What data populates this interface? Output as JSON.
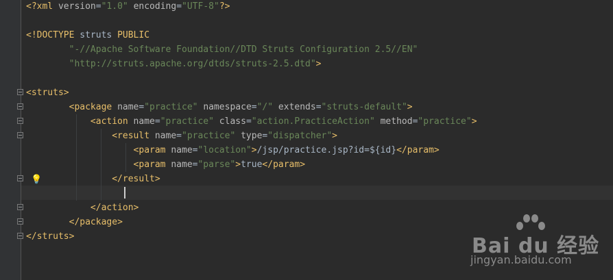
{
  "editor": {
    "lines": [
      {
        "segments": [
          {
            "text": "<?xml ",
            "cls": "t-tag"
          },
          {
            "text": "version",
            "cls": "t-attr"
          },
          {
            "text": "=",
            "cls": "t-text"
          },
          {
            "text": "\"1.0\"",
            "cls": "t-val"
          },
          {
            "text": " ",
            "cls": "t-text"
          },
          {
            "text": "encoding",
            "cls": "t-attr"
          },
          {
            "text": "=",
            "cls": "t-text"
          },
          {
            "text": "\"UTF-8\"",
            "cls": "t-val"
          },
          {
            "text": "?>",
            "cls": "t-tag"
          }
        ]
      },
      {
        "segments": []
      },
      {
        "segments": [
          {
            "text": "<!DOCTYPE ",
            "cls": "t-tag"
          },
          {
            "text": "struts ",
            "cls": "t-text"
          },
          {
            "text": "PUBLIC",
            "cls": "t-tag"
          }
        ]
      },
      {
        "segments": [
          {
            "text": "        ",
            "cls": "t-text"
          },
          {
            "text": "\"-//Apache Software Foundation//DTD Struts Configuration 2.5//EN\"",
            "cls": "t-val"
          }
        ]
      },
      {
        "segments": [
          {
            "text": "        ",
            "cls": "t-text"
          },
          {
            "text": "\"http://struts.apache.org/dtds/struts-2.5.dtd\"",
            "cls": "t-val"
          },
          {
            "text": ">",
            "cls": "t-tag"
          }
        ]
      },
      {
        "segments": []
      },
      {
        "segments": [
          {
            "text": "<struts>",
            "cls": "t-tag"
          }
        ]
      },
      {
        "segments": [
          {
            "text": "        ",
            "cls": "t-text"
          },
          {
            "text": "<package ",
            "cls": "t-tag"
          },
          {
            "text": "name",
            "cls": "t-attr"
          },
          {
            "text": "=",
            "cls": "t-text"
          },
          {
            "text": "\"practice\"",
            "cls": "t-val"
          },
          {
            "text": " ",
            "cls": "t-text"
          },
          {
            "text": "namespace",
            "cls": "t-attr"
          },
          {
            "text": "=",
            "cls": "t-text"
          },
          {
            "text": "\"/\"",
            "cls": "t-val"
          },
          {
            "text": " ",
            "cls": "t-text"
          },
          {
            "text": "extends",
            "cls": "t-attr"
          },
          {
            "text": "=",
            "cls": "t-text"
          },
          {
            "text": "\"struts-default\"",
            "cls": "t-val"
          },
          {
            "text": ">",
            "cls": "t-tag"
          }
        ]
      },
      {
        "segments": [
          {
            "text": "            ",
            "cls": "t-text"
          },
          {
            "text": "<action ",
            "cls": "t-tag"
          },
          {
            "text": "name",
            "cls": "t-attr"
          },
          {
            "text": "=",
            "cls": "t-text"
          },
          {
            "text": "\"practice\"",
            "cls": "t-val"
          },
          {
            "text": " ",
            "cls": "t-text"
          },
          {
            "text": "class",
            "cls": "t-attr"
          },
          {
            "text": "=",
            "cls": "t-text"
          },
          {
            "text": "\"action.PracticeAction\"",
            "cls": "t-val"
          },
          {
            "text": " ",
            "cls": "t-text"
          },
          {
            "text": "method",
            "cls": "t-attr"
          },
          {
            "text": "=",
            "cls": "t-text"
          },
          {
            "text": "\"practice\"",
            "cls": "t-val"
          },
          {
            "text": ">",
            "cls": "t-tag"
          }
        ]
      },
      {
        "segments": [
          {
            "text": "                ",
            "cls": "t-text"
          },
          {
            "text": "<result ",
            "cls": "t-tag"
          },
          {
            "text": "name",
            "cls": "t-attr"
          },
          {
            "text": "=",
            "cls": "t-text"
          },
          {
            "text": "\"practice\"",
            "cls": "t-val"
          },
          {
            "text": " ",
            "cls": "t-text"
          },
          {
            "text": "type",
            "cls": "t-attr"
          },
          {
            "text": "=",
            "cls": "t-text"
          },
          {
            "text": "\"dispatcher\"",
            "cls": "t-val"
          },
          {
            "text": ">",
            "cls": "t-tag"
          }
        ]
      },
      {
        "segments": [
          {
            "text": "                    ",
            "cls": "t-text"
          },
          {
            "text": "<param ",
            "cls": "t-tag"
          },
          {
            "text": "name",
            "cls": "t-attr"
          },
          {
            "text": "=",
            "cls": "t-text"
          },
          {
            "text": "\"location\"",
            "cls": "t-val"
          },
          {
            "text": ">",
            "cls": "t-tag"
          },
          {
            "text": "/jsp/practice.jsp?id=${id}",
            "cls": "t-text"
          },
          {
            "text": "</param>",
            "cls": "t-tag"
          }
        ]
      },
      {
        "segments": [
          {
            "text": "                    ",
            "cls": "t-text"
          },
          {
            "text": "<param ",
            "cls": "t-tag"
          },
          {
            "text": "name",
            "cls": "t-attr"
          },
          {
            "text": "=",
            "cls": "t-text"
          },
          {
            "text": "\"parse\"",
            "cls": "t-val"
          },
          {
            "text": ">",
            "cls": "t-tag"
          },
          {
            "text": "true",
            "cls": "t-text"
          },
          {
            "text": "</param>",
            "cls": "t-tag"
          }
        ]
      },
      {
        "segments": [
          {
            "text": "                ",
            "cls": "t-text"
          },
          {
            "text": "</result>",
            "cls": "t-tag"
          }
        ]
      },
      {
        "segments": []
      },
      {
        "segments": [
          {
            "text": "            ",
            "cls": "t-text"
          },
          {
            "text": "</action>",
            "cls": "t-tag"
          }
        ]
      },
      {
        "segments": [
          {
            "text": "        ",
            "cls": "t-text"
          },
          {
            "text": "</package>",
            "cls": "t-tag"
          }
        ]
      },
      {
        "segments": [
          {
            "text": "</struts>",
            "cls": "t-tag"
          }
        ]
      }
    ]
  },
  "watermark": {
    "brand": "Bai du 经验",
    "url": "jingyan.baidu.com"
  },
  "colors": {
    "background": "#2b2b2b",
    "tag": "#e8bf6a",
    "attribute": "#bababa",
    "value": "#6a8759",
    "text": "#a9b7c6"
  }
}
